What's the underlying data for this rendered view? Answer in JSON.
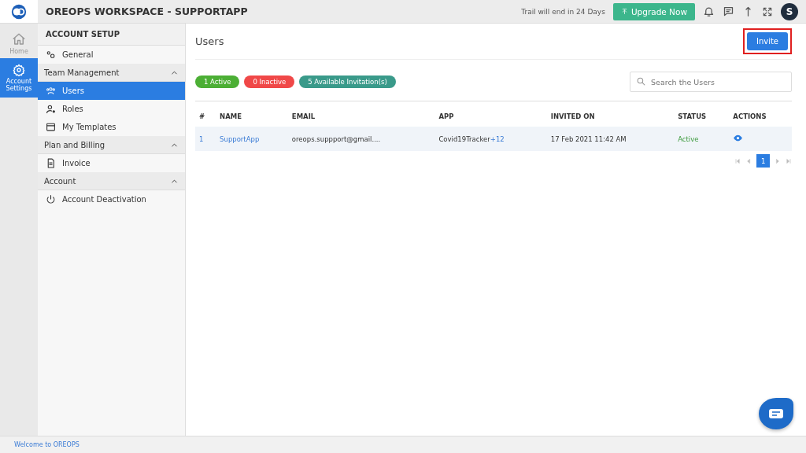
{
  "header": {
    "title": "OREOPS WORKSPACE - SUPPORTAPP",
    "trial_text": "Trail will end in 24 Days",
    "upgrade_button": "Upgrade Now",
    "avatar": "S"
  },
  "rail": [
    {
      "label": "Home",
      "selected": false
    },
    {
      "label": "Account Settings",
      "selected": true
    }
  ],
  "sidebar": {
    "heading": "ACCOUNT SETUP",
    "entries": [
      {
        "kind": "link",
        "label": "General",
        "selected": false
      },
      {
        "kind": "group",
        "label": "Team Management",
        "expanded": true,
        "children": [
          {
            "label": "Users",
            "selected": true
          },
          {
            "label": "Roles",
            "selected": false
          },
          {
            "label": "My Templates",
            "selected": false
          }
        ]
      },
      {
        "kind": "group",
        "label": "Plan and Billing",
        "expanded": true,
        "children": [
          {
            "label": "Invoice",
            "selected": false
          }
        ]
      },
      {
        "kind": "group",
        "label": "Account",
        "expanded": true,
        "children": [
          {
            "label": "Account Deactivation",
            "selected": false
          }
        ]
      }
    ]
  },
  "page": {
    "title": "Users",
    "invite_button": {
      "label": "Invite",
      "highlighted": true
    },
    "badges": [
      {
        "label": "1 Active",
        "color": "#4caf35"
      },
      {
        "label": "0 Inactive",
        "color": "#f04848"
      },
      {
        "label": "5 Available Invitation(s)",
        "color": "#3a9a8a"
      }
    ],
    "search": {
      "placeholder": "Search the Users"
    },
    "table": {
      "columns": [
        "#",
        "NAME",
        "EMAIL",
        "APP",
        "INVITED ON",
        "STATUS",
        "ACTIONS"
      ],
      "rows": [
        {
          "index": "1",
          "name": "SupportApp",
          "email": "oreops.suppport@gmail....",
          "app": "Covid19Tracker",
          "app_more": "+12",
          "invited_on": "17 Feb 2021 11:42 AM",
          "status": "Active"
        }
      ]
    },
    "pagination": {
      "pages": [
        {
          "label": "1",
          "selected": true
        }
      ]
    }
  },
  "footer": {
    "text": "Welcome to OREOPS"
  }
}
